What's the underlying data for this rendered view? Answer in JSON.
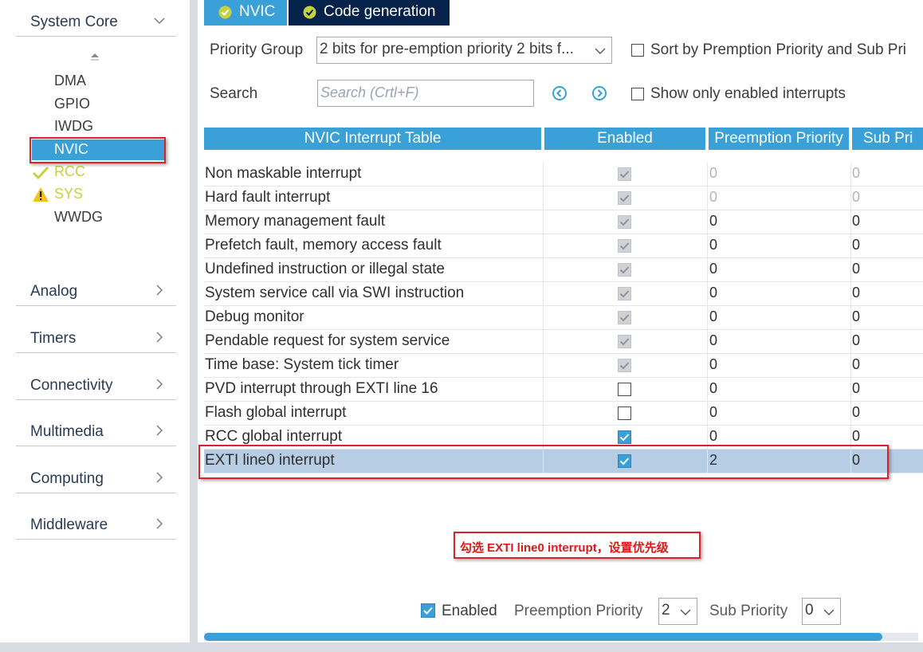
{
  "sidebar": {
    "system_core": "System Core",
    "peripherals": [
      "DMA",
      "GPIO",
      "IWDG",
      "NVIC",
      "RCC",
      "SYS",
      "WWDG"
    ],
    "categories": [
      "Analog",
      "Timers",
      "Connectivity",
      "Multimedia",
      "Computing",
      "Middleware"
    ]
  },
  "tabs": [
    {
      "label": "NVIC"
    },
    {
      "label": "Code generation"
    }
  ],
  "config": {
    "priority_group_label": "Priority Group",
    "priority_group_value": "2 bits for pre-emption priority 2 bits f...",
    "sort_label": "Sort by Premption Priority and Sub Pri",
    "search_label": "Search",
    "search_placeholder": "Search (Crtl+F)",
    "show_enabled_label": "Show only enabled interrupts"
  },
  "table": {
    "headers": [
      "NVIC Interrupt Table",
      "Enabled",
      "Preemption Priority",
      "Sub Pri"
    ],
    "rows": [
      {
        "name": "Non maskable interrupt",
        "enabled": true,
        "locked": true,
        "preemption": "0",
        "sub": "0",
        "muted": true
      },
      {
        "name": "Hard fault interrupt",
        "enabled": true,
        "locked": true,
        "preemption": "0",
        "sub": "0",
        "muted": true
      },
      {
        "name": "Memory management fault",
        "enabled": true,
        "locked": true,
        "preemption": "0",
        "sub": "0"
      },
      {
        "name": "Prefetch fault, memory access fault",
        "enabled": true,
        "locked": true,
        "preemption": "0",
        "sub": "0"
      },
      {
        "name": "Undefined instruction or illegal state",
        "enabled": true,
        "locked": true,
        "preemption": "0",
        "sub": "0"
      },
      {
        "name": "System service call via SWI instruction",
        "enabled": true,
        "locked": true,
        "preemption": "0",
        "sub": "0"
      },
      {
        "name": "Debug monitor",
        "enabled": true,
        "locked": true,
        "preemption": "0",
        "sub": "0"
      },
      {
        "name": "Pendable request for system service",
        "enabled": true,
        "locked": true,
        "preemption": "0",
        "sub": "0"
      },
      {
        "name": "Time base: System tick timer",
        "enabled": true,
        "locked": true,
        "preemption": "0",
        "sub": "0"
      },
      {
        "name": "PVD interrupt through EXTI line 16",
        "enabled": false,
        "preemption": "0",
        "sub": "0"
      },
      {
        "name": "Flash global interrupt",
        "enabled": false,
        "preemption": "0",
        "sub": "0"
      },
      {
        "name": "RCC global interrupt",
        "enabled": true,
        "preemption": "0",
        "sub": "0"
      },
      {
        "name": "EXTI line0 interrupt",
        "enabled": true,
        "preemption": "2",
        "sub": "0",
        "selected": true
      }
    ]
  },
  "annotation": "勾选 EXTI line0 interrupt，设置优先级",
  "footer": {
    "enabled_label": "Enabled",
    "preemption_label": "Preemption Priority",
    "preemption_value": "2",
    "sub_label": "Sub Priority",
    "sub_value": "0",
    "progress": 0.95
  },
  "colors": {
    "accent": "#39a0d8",
    "dark_tab": "#04224a",
    "annotation_red": "#d9232a",
    "selected_row": "#b7cde4",
    "status_green_yellow": "#c8d240"
  }
}
